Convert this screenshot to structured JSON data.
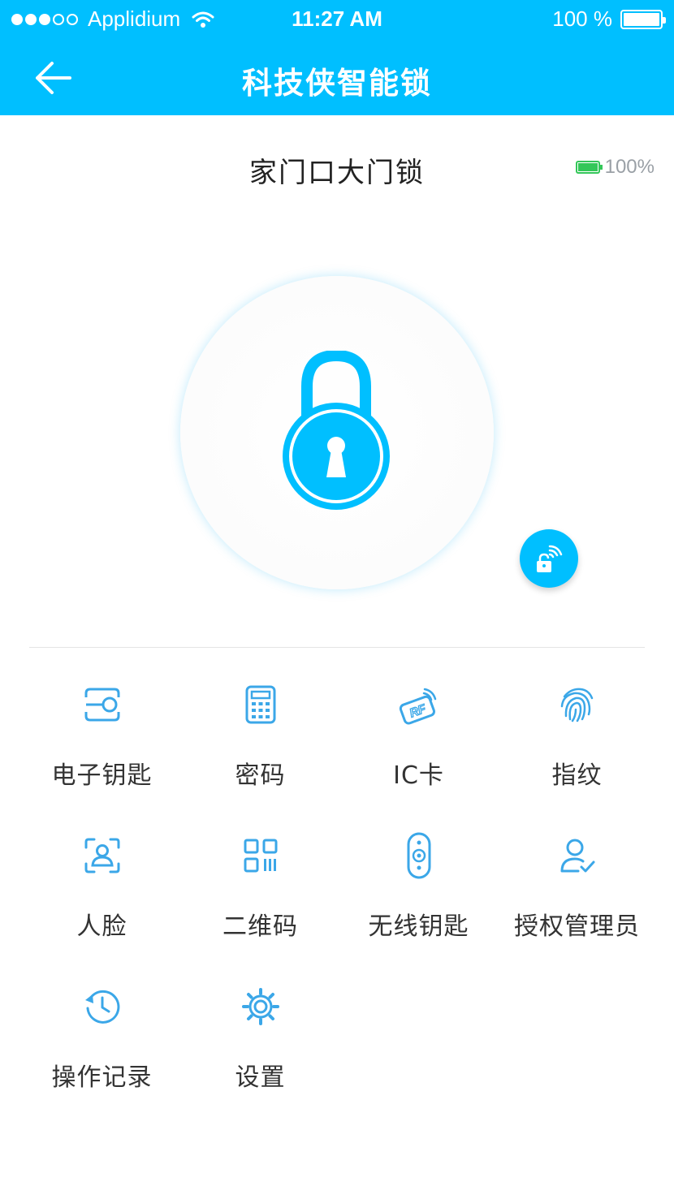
{
  "status_bar": {
    "carrier": "Applidium",
    "time": "11:27 AM",
    "battery": "100 %"
  },
  "nav": {
    "title": "科技侠智能锁",
    "back_icon": "back-arrow-icon"
  },
  "device": {
    "name": "家门口大门锁",
    "battery_text": "100%",
    "battery_level": 1.0
  },
  "colors": {
    "primary": "#00BFFF",
    "icon": "#3BA7E8",
    "battery_green": "#34C759"
  },
  "menu": [
    {
      "label": "电子钥匙",
      "icon": "electronic-key-icon"
    },
    {
      "label": "密码",
      "icon": "keypad-icon"
    },
    {
      "label": "IC卡",
      "icon": "rf-card-icon"
    },
    {
      "label": "指纹",
      "icon": "fingerprint-icon"
    },
    {
      "label": "人脸",
      "icon": "face-scan-icon"
    },
    {
      "label": "二维码",
      "icon": "qr-code-icon"
    },
    {
      "label": "无线钥匙",
      "icon": "remote-fob-icon"
    },
    {
      "label": "授权管理员",
      "icon": "authorized-admin-icon"
    },
    {
      "label": "操作记录",
      "icon": "history-icon"
    },
    {
      "label": "设置",
      "icon": "settings-gear-icon"
    }
  ]
}
